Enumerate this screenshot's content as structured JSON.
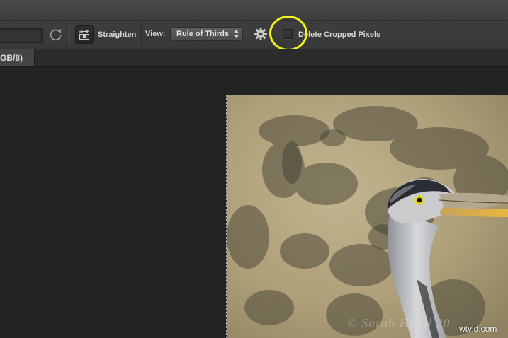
{
  "options_bar": {
    "straighten_label": "Straighten",
    "view_label": "View:",
    "view_value": "Rule of Thirds",
    "delete_cropped_label": "Delete Cropped Pixels",
    "delete_cropped_checked": false,
    "icons": [
      "rotate-icon",
      "straighten-icon",
      "chevron-updown-icon",
      "gear-icon"
    ]
  },
  "document_tab": {
    "label": "GB/8)"
  },
  "canvas": {
    "watermark": "© Sarah Hi   ell 20",
    "site_mark": "wtvid.com"
  },
  "annotation": {
    "highlight_color": "#f2f21a"
  }
}
